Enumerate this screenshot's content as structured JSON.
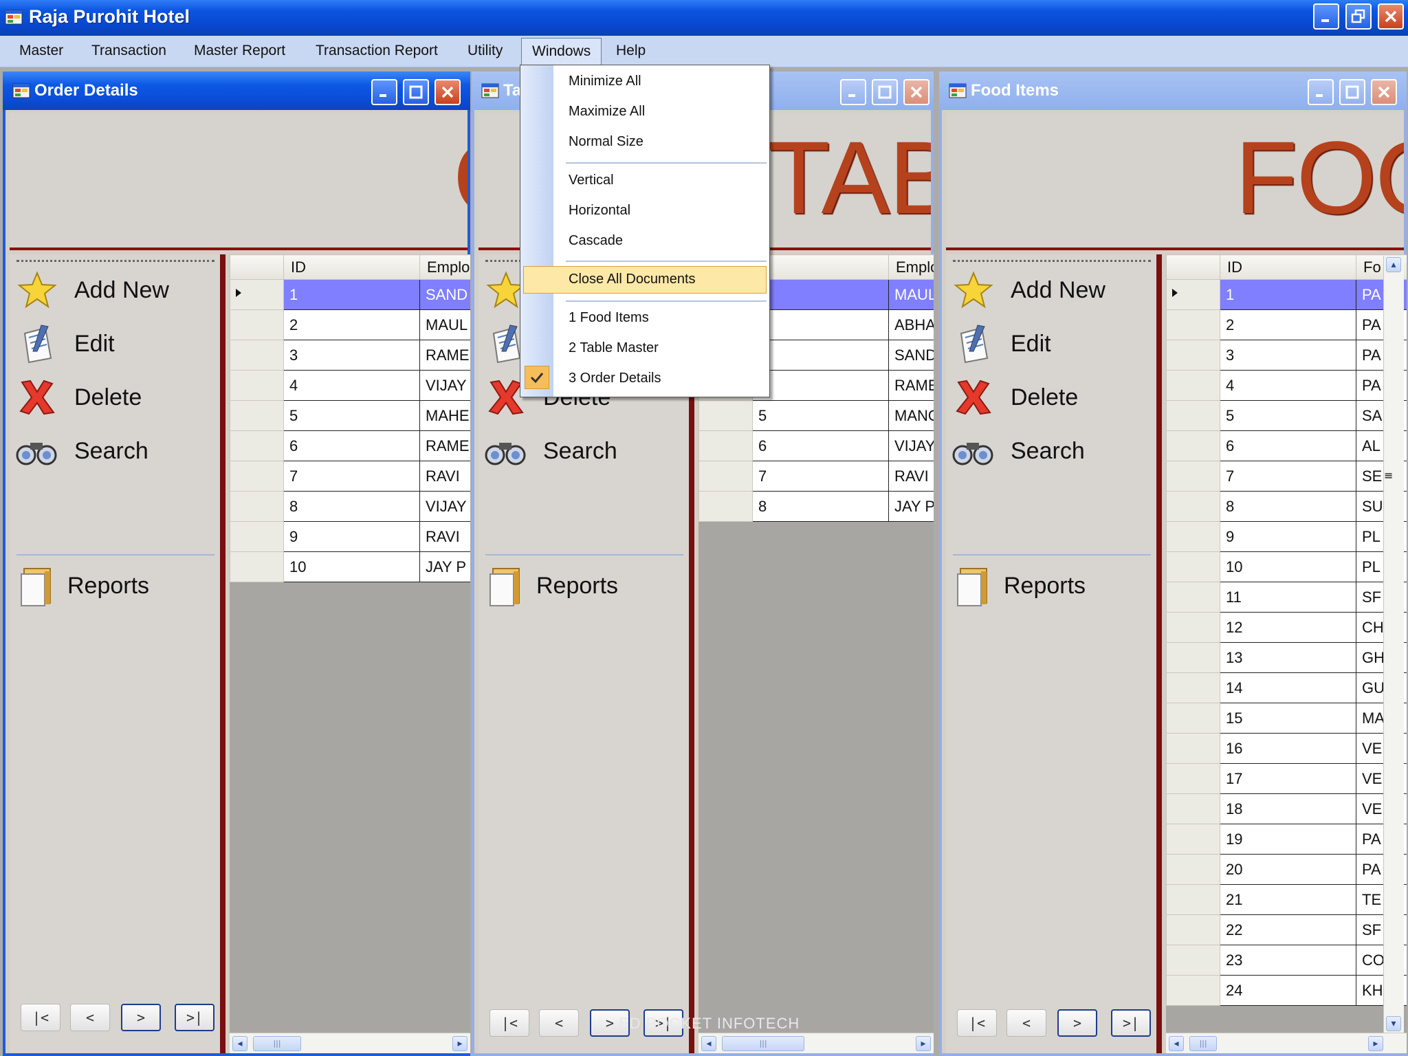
{
  "app": {
    "title": "Raja Purohit Hotel"
  },
  "menubar": [
    "Master",
    "Transaction",
    "Master Report",
    "Transaction Report",
    "Utility",
    "Windows",
    "Help"
  ],
  "windows_menu": {
    "items": [
      "Minimize All",
      "Maximize All",
      "Normal Size",
      "Vertical",
      "Horizontal",
      "Cascade",
      "Close All Documents",
      "1 Food Items",
      "2 Table Master",
      "3 Order Details"
    ],
    "highlighted": "Close All Documents",
    "checked": "3 Order Details"
  },
  "actions": {
    "add": "Add New",
    "edit": "Edit",
    "delete": "Delete",
    "search": "Search",
    "reports": "Reports"
  },
  "nav": {
    "first": "|<",
    "prev": "<",
    "next": ">",
    "last": ">|"
  },
  "order_details": {
    "title": "Order Details",
    "banner": "O",
    "columns": [
      "ID",
      "Emplo"
    ],
    "rows": [
      [
        "1",
        "SAND"
      ],
      [
        "2",
        "MAUL"
      ],
      [
        "3",
        "RAME"
      ],
      [
        "4",
        "VIJAY"
      ],
      [
        "5",
        "MAHE"
      ],
      [
        "6",
        "RAME"
      ],
      [
        "7",
        "RAVI"
      ],
      [
        "8",
        "VIJAY"
      ],
      [
        "9",
        "RAVI"
      ],
      [
        "10",
        "JAY P"
      ]
    ]
  },
  "table_master": {
    "title": "Ta",
    "banner": "TABL",
    "columns": [
      "D",
      "Emplo"
    ],
    "rows": [
      [
        "",
        "MAUL"
      ],
      [
        "",
        "ABHA"
      ],
      [
        "",
        "SAND"
      ],
      [
        "",
        "RAME"
      ],
      [
        "5",
        "MANO"
      ],
      [
        "6",
        "VIJAY"
      ],
      [
        "7",
        "RAVI"
      ],
      [
        "8",
        "JAY P"
      ]
    ]
  },
  "food_items": {
    "title": "Food Items",
    "banner": "FOO",
    "columns": [
      "ID",
      "Fo"
    ],
    "rows": [
      [
        "1",
        "PA"
      ],
      [
        "2",
        "PA"
      ],
      [
        "3",
        "PA"
      ],
      [
        "4",
        "PA"
      ],
      [
        "5",
        "SA"
      ],
      [
        "6",
        "AL"
      ],
      [
        "7",
        "SE"
      ],
      [
        "8",
        "SU"
      ],
      [
        "9",
        "PL"
      ],
      [
        "10",
        "PL"
      ],
      [
        "11",
        "SF"
      ],
      [
        "12",
        "CH"
      ],
      [
        "13",
        "GH"
      ],
      [
        "14",
        "GU"
      ],
      [
        "15",
        "MA"
      ],
      [
        "16",
        "VE"
      ],
      [
        "17",
        "VE"
      ],
      [
        "18",
        "VE"
      ],
      [
        "19",
        "PA"
      ],
      [
        "20",
        "PA"
      ],
      [
        "21",
        "TE"
      ],
      [
        "22",
        "SF"
      ],
      [
        "23",
        "CO"
      ],
      [
        "24",
        "KH"
      ]
    ]
  },
  "watermark": "ED POCKET INFOTECH",
  "colors": {
    "accent": "#0b55e0",
    "selected_row": "#7f7fff",
    "banner_text": "#b5421c",
    "divider": "#7a0f0f"
  }
}
